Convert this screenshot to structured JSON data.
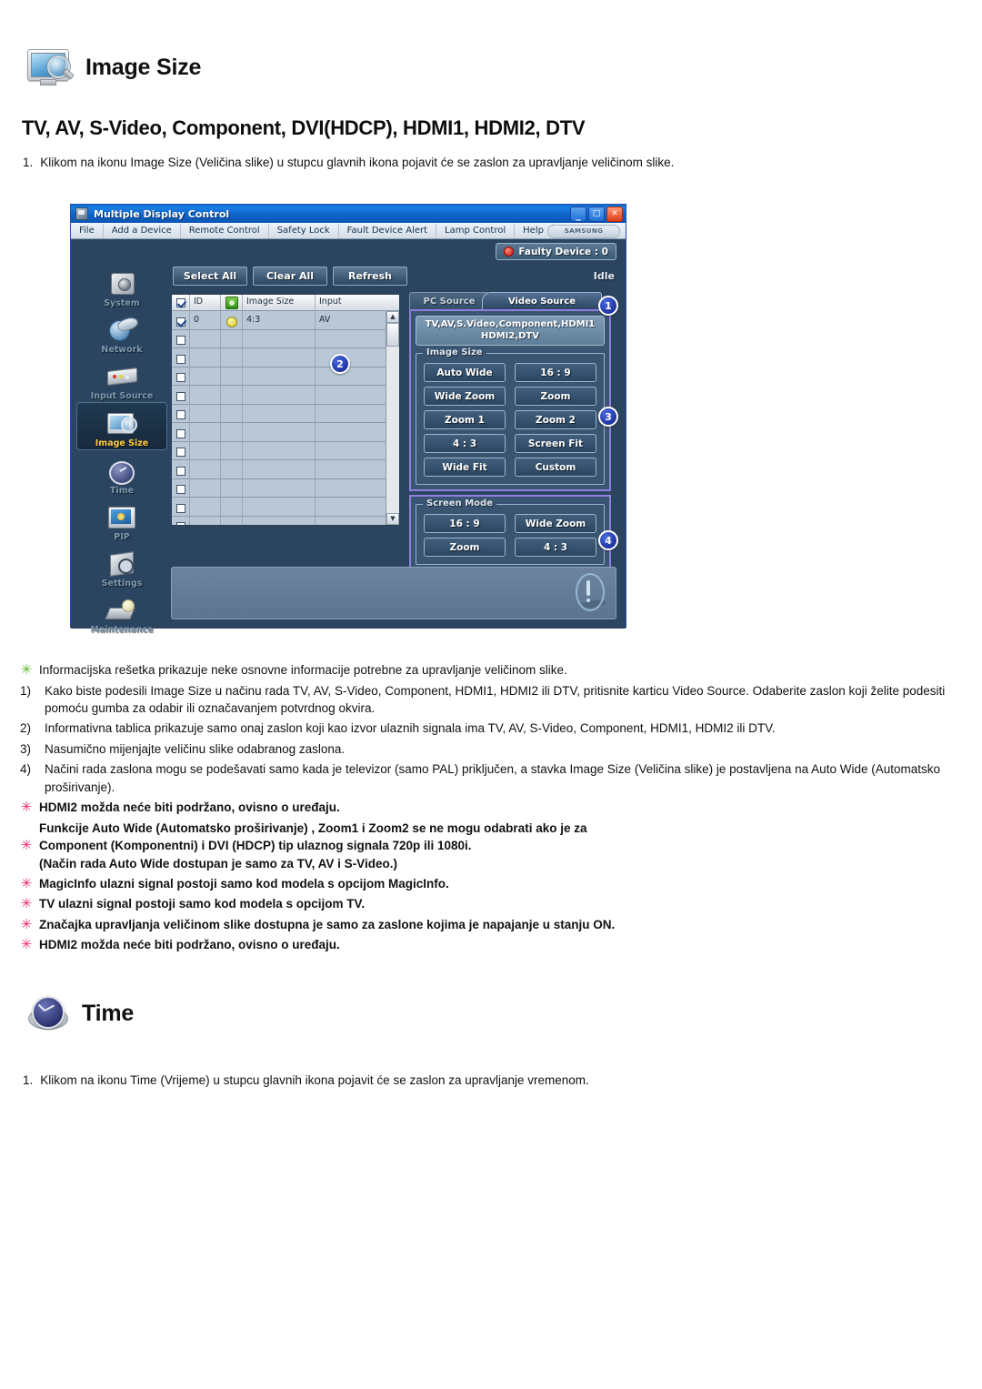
{
  "page": {
    "section_title": "Image Size",
    "subtitle": "TV, AV, S-Video, Component, DVI(HDCP), HDMI1, HDMI2, DTV",
    "intro_number": "1.",
    "intro_text": "Klikom na ikonu Image Size (Veličina slike) u stupcu glavnih ikona pojavit će se zaslon za upravljanje veličinom slike.",
    "time_section_title": "Time",
    "time_intro_number": "1.",
    "time_intro_text": "Klikom na ikonu Time (Vrijeme) u stupcu glavnih ikona pojavit će se zaslon za upravljanje vremenom."
  },
  "app": {
    "title": "Multiple Display Control",
    "window_buttons": {
      "minimize": "_",
      "maximize": "□",
      "close": "✕"
    },
    "menu": [
      "File",
      "Add a Device",
      "Remote Control",
      "Safety Lock",
      "Fault Device Alert",
      "Lamp Control",
      "Help"
    ],
    "brand": "SAMSUNG DIGITall",
    "faulty_device": "Faulty Device : 0",
    "status": "Idle",
    "toolbar": [
      "Select All",
      "Clear All",
      "Refresh"
    ],
    "sidebar": [
      {
        "label": "System"
      },
      {
        "label": "Network"
      },
      {
        "label": "Input Source"
      },
      {
        "label": "Image Size"
      },
      {
        "label": "Time"
      },
      {
        "label": "PIP"
      },
      {
        "label": "Settings"
      },
      {
        "label": "Maintenance"
      }
    ],
    "sidebar_active": "Image Size",
    "grid": {
      "columns": [
        "",
        "ID",
        "",
        "Image Size",
        "Input"
      ],
      "rows": [
        {
          "checked": true,
          "id": "0",
          "power": true,
          "image_size": "4:3",
          "input": "AV"
        },
        {
          "checked": false,
          "id": "",
          "power": false,
          "image_size": "",
          "input": ""
        },
        {
          "checked": false,
          "id": "",
          "power": false,
          "image_size": "",
          "input": ""
        },
        {
          "checked": false,
          "id": "",
          "power": false,
          "image_size": "",
          "input": ""
        },
        {
          "checked": false,
          "id": "",
          "power": false,
          "image_size": "",
          "input": ""
        },
        {
          "checked": false,
          "id": "",
          "power": false,
          "image_size": "",
          "input": ""
        },
        {
          "checked": false,
          "id": "",
          "power": false,
          "image_size": "",
          "input": ""
        },
        {
          "checked": false,
          "id": "",
          "power": false,
          "image_size": "",
          "input": ""
        },
        {
          "checked": false,
          "id": "",
          "power": false,
          "image_size": "",
          "input": ""
        },
        {
          "checked": false,
          "id": "",
          "power": false,
          "image_size": "",
          "input": ""
        },
        {
          "checked": false,
          "id": "",
          "power": false,
          "image_size": "",
          "input": ""
        },
        {
          "checked": false,
          "id": "",
          "power": false,
          "image_size": "",
          "input": ""
        }
      ]
    },
    "tabs": {
      "inactive": "PC Source",
      "active": "Video Source"
    },
    "source_title": "TV,AV,S.Video,Component,HDMI1\nHDMI2,DTV",
    "image_size_group": {
      "legend": "Image Size",
      "buttons": [
        "Auto Wide",
        "16 : 9",
        "Wide Zoom",
        "Zoom",
        "Zoom 1",
        "Zoom 2",
        "4 : 3",
        "Screen Fit",
        "Wide Fit",
        "Custom"
      ]
    },
    "screen_mode_group": {
      "legend": "Screen Mode",
      "buttons": [
        "16 : 9",
        "Wide Zoom",
        "Zoom",
        "4 : 3"
      ]
    },
    "callouts": [
      "1",
      "2",
      "3",
      "4"
    ]
  },
  "notes": [
    {
      "marker": "star-green",
      "text": "Informacijska rešetka prikazuje neke osnovne informacije potrebne za upravljanje veličinom slike.",
      "bold": false
    },
    {
      "marker": "1)",
      "text": "Kako biste podesili Image Size u načinu rada TV, AV, S-Video, Component, HDMI1, HDMI2 ili DTV, pritisnite karticu Video Source. Odaberite zaslon koji želite podesiti pomoću gumba za odabir ili označavanjem potvrdnog okvira.",
      "bold": false
    },
    {
      "marker": "2)",
      "text": "Informativna tablica prikazuje samo onaj zaslon koji kao izvor ulaznih signala ima TV, AV, S-Video, Component, HDMI1, HDMI2 ili DTV.",
      "bold": false
    },
    {
      "marker": "3)",
      "text": "Nasumično mijenjajte veličinu slike odabranog zaslona.",
      "bold": false
    },
    {
      "marker": "4)",
      "text": "Načini rada zaslona mogu se podešavati samo kada je televizor (samo PAL) priključen, a stavka Image Size (Veličina slike) je postavljena na Auto Wide (Automatsko proširivanje).",
      "bold": false
    },
    {
      "marker": "star-pink",
      "text": "HDMI2 možda neće biti podržano, ovisno o uređaju.",
      "bold": true
    },
    {
      "marker": "star-pink",
      "text": "Funkcije Auto Wide (Automatsko proširivanje) , Zoom1 i Zoom2 se ne mogu odabrati ako je za\nComponent (Komponentni) i DVI (HDCP) tip ulaznog signala 720p ili 1080i.\n(Način rada Auto Wide dostupan je samo za TV, AV i S-Video.)",
      "bold": true
    },
    {
      "marker": "star-pink",
      "text": "MagicInfo ulazni signal postoji samo kod modela s opcijom MagicInfo.",
      "bold": true
    },
    {
      "marker": "star-pink",
      "text": "TV ulazni signal postoji samo kod modela s opcijom TV.",
      "bold": true
    },
    {
      "marker": "star-pink",
      "text": "Značajka upravljanja veličinom slike dostupna je samo za zaslone kojima je napajanje u stanju ON.",
      "bold": true
    },
    {
      "marker": "star-pink",
      "text": "HDMI2 možda neće biti podržano, ovisno o uređaju.",
      "bold": true
    }
  ]
}
